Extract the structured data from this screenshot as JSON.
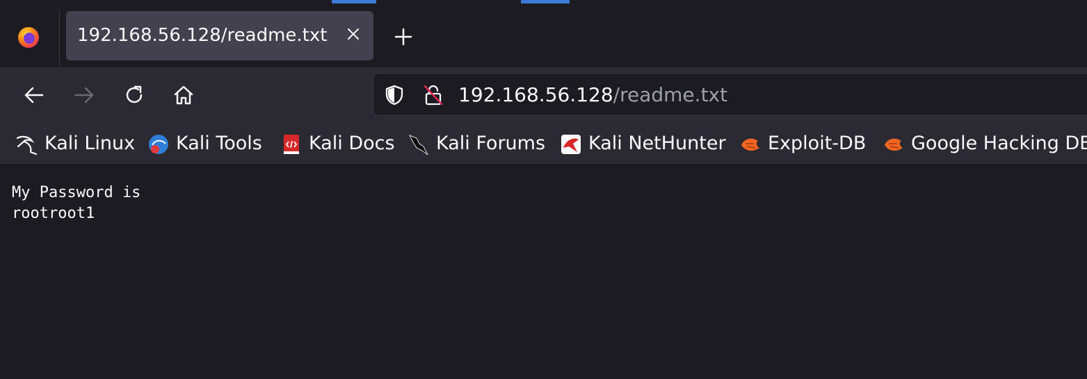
{
  "tab": {
    "title": "192.168.56.128/readme.txt"
  },
  "urlbar": {
    "host": "192.168.56.128",
    "path": "/readme.txt"
  },
  "bookmarks": [
    {
      "label": "Kali Linux",
      "icon": "kali-dragon-icon"
    },
    {
      "label": "Kali Tools",
      "icon": "kali-tools-icon"
    },
    {
      "label": "Kali Docs",
      "icon": "kali-docs-icon"
    },
    {
      "label": "Kali Forums",
      "icon": "kali-forums-icon"
    },
    {
      "label": "Kali NetHunter",
      "icon": "kali-nethunter-icon"
    },
    {
      "label": "Exploit-DB",
      "icon": "exploit-db-icon"
    },
    {
      "label": "Google Hacking DB",
      "icon": "exploit-db-icon"
    }
  ],
  "page": {
    "lines": [
      "My Password is",
      "rootroot1"
    ]
  },
  "colors": {
    "accent": "#3b7bd4",
    "background": "#1c1b22",
    "toolbar": "#2b2a33"
  }
}
